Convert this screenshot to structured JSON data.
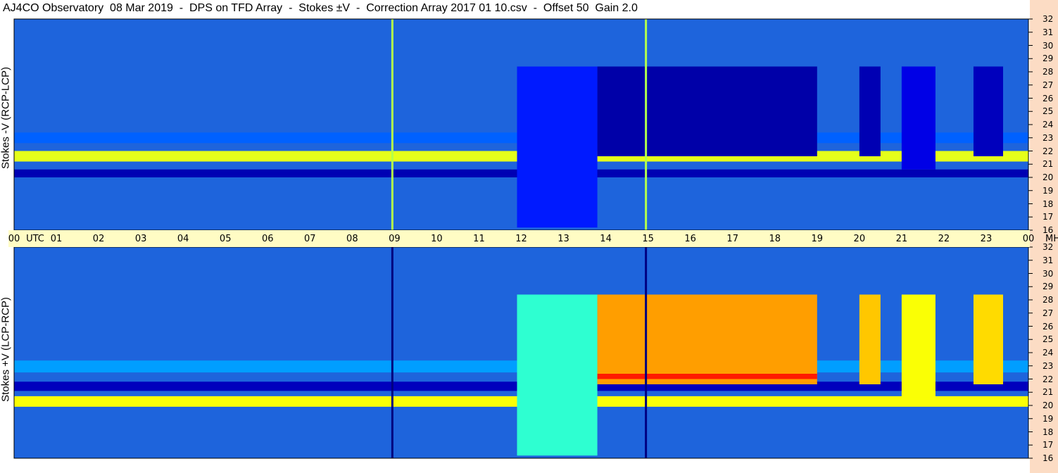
{
  "title": "AJ4CO Observatory  08 Mar 2019  -  DPS on TFD Array  -  Stokes ±V  -  Correction Array 2017 01 10.csv  -  Offset 50  Gain 2.0",
  "panels": {
    "top_label": "Stokes -V (RCP-LCP)",
    "bottom_label": "Stokes +V (LCP-RCP)"
  },
  "time_axis": {
    "labels": [
      "00",
      "UTC",
      "01",
      "02",
      "03",
      "04",
      "05",
      "06",
      "07",
      "08",
      "09",
      "10",
      "11",
      "12",
      "13",
      "14",
      "15",
      "16",
      "17",
      "18",
      "19",
      "20",
      "21",
      "22",
      "23",
      "00",
      "MHz"
    ]
  },
  "freq_axis": {
    "labels": [
      "32",
      "31",
      "30",
      "29",
      "28",
      "27",
      "26",
      "25",
      "24",
      "23",
      "22",
      "21",
      "20",
      "19",
      "18",
      "17",
      "16"
    ]
  },
  "colors": {
    "background": "#ffffff",
    "time_axis_band": "#fffcc4",
    "right_strip": "#fcdcc4",
    "spectrogram_base": "#1e64dc"
  },
  "chart_data": [
    {
      "type": "heatmap",
      "name": "Stokes -V (RCP-LCP)",
      "x_unit": "UTC hour",
      "y_unit": "MHz",
      "xlim": [
        0,
        24
      ],
      "ylim": [
        16,
        32
      ],
      "colormap": "jet",
      "bands": [
        {
          "y": [
            20.0,
            20.6
          ],
          "level": 0.05
        },
        {
          "y": [
            21.2,
            22.0
          ],
          "level": 0.6
        },
        {
          "y": [
            22.6,
            23.4
          ],
          "level": 0.22
        }
      ],
      "regions": [
        {
          "x": [
            11.9,
            13.8
          ],
          "y": [
            16.2,
            28.4
          ],
          "level": 0.15
        },
        {
          "x": [
            13.8,
            19.0
          ],
          "y": [
            21.6,
            28.4
          ],
          "level": 0.04
        },
        {
          "x": [
            20.0,
            20.5
          ],
          "y": [
            21.6,
            28.4
          ],
          "level": 0.05
        },
        {
          "x": [
            21.0,
            21.8
          ],
          "y": [
            20.6,
            28.4
          ],
          "level": 0.1
        },
        {
          "x": [
            22.7,
            23.4
          ],
          "y": [
            21.6,
            28.4
          ],
          "level": 0.06
        }
      ],
      "vertical_lines": [
        {
          "x": 8.95,
          "level": 0.55
        },
        {
          "x": 14.95,
          "level": 0.55
        }
      ]
    },
    {
      "type": "heatmap",
      "name": "Stokes +V (LCP-RCP)",
      "x_unit": "UTC hour",
      "y_unit": "MHz",
      "xlim": [
        0,
        24
      ],
      "ylim": [
        16,
        32
      ],
      "colormap": "jet",
      "bands": [
        {
          "y": [
            19.9,
            20.7
          ],
          "level": 0.62
        },
        {
          "y": [
            21.1,
            21.8
          ],
          "level": 0.06
        },
        {
          "y": [
            22.5,
            23.4
          ],
          "level": 0.28
        }
      ],
      "regions": [
        {
          "x": [
            11.9,
            13.8
          ],
          "y": [
            16.2,
            28.4
          ],
          "level": 0.42
        },
        {
          "x": [
            13.8,
            19.0
          ],
          "y": [
            21.6,
            28.4
          ],
          "level": 0.72
        },
        {
          "x": [
            13.8,
            19.0
          ],
          "y": [
            22.0,
            22.4
          ],
          "level": 0.85
        },
        {
          "x": [
            20.0,
            20.5
          ],
          "y": [
            21.6,
            28.4
          ],
          "level": 0.68
        },
        {
          "x": [
            21.0,
            21.8
          ],
          "y": [
            20.6,
            28.4
          ],
          "level": 0.62
        },
        {
          "x": [
            22.7,
            23.4
          ],
          "y": [
            21.6,
            28.4
          ],
          "level": 0.66
        }
      ],
      "vertical_lines": [
        {
          "x": 8.95,
          "level": 0.0
        },
        {
          "x": 14.95,
          "level": 0.0
        }
      ]
    }
  ]
}
